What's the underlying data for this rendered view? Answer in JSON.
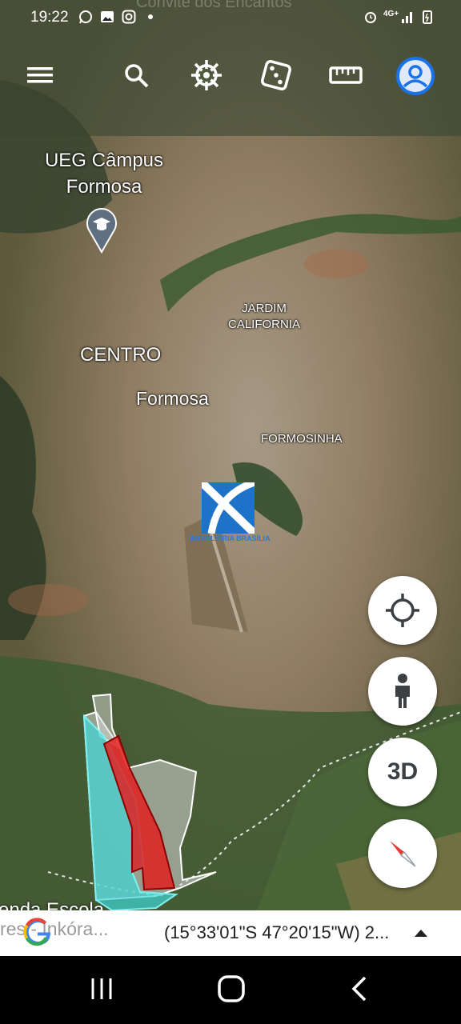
{
  "status_bar": {
    "time": "19:22",
    "network": "4G+",
    "faded_title": "Convite dos Encantos",
    "icons": [
      "whatsapp-icon",
      "gallery-icon",
      "instagram-icon",
      "alarm-icon",
      "signal-icon",
      "battery-icon"
    ]
  },
  "toolbar": {
    "icons": [
      "menu-icon",
      "search-icon",
      "voyager-icon",
      "feeling-lucky-icon",
      "measure-icon",
      "account-icon"
    ]
  },
  "map_labels": {
    "poi": "UEG Câmpus Formosa",
    "neighborhood_1": "JARDIM CALIFORNIA",
    "centro": "CENTRO",
    "city": "Formosa",
    "neighborhood_2": "FORMOSINHA",
    "watermark": "IMOBILIÁRIA BRASÍLIA",
    "partial_bottom_1": "enda Escola",
    "partial_bottom_2": "res - Inkóra..."
  },
  "fabs": {
    "locate_icon": "crosshair-icon",
    "streetview_icon": "pegman-icon",
    "threed_label": "3D",
    "compass_icon": "compass-icon"
  },
  "bottom_bar": {
    "coords": "(15°33'01\"S 47°20'15\"W) 2...",
    "logo": "google-g-icon",
    "expand_icon": "caret-up-icon"
  },
  "nav_bar": {
    "icons": [
      "recents-icon",
      "home-icon",
      "back-icon"
    ]
  },
  "colors": {
    "accent_blue": "#1a73e8",
    "parcel_cyan": "#3ed6d6",
    "parcel_red": "#e02020",
    "parcel_white": "#d9d9d9"
  }
}
